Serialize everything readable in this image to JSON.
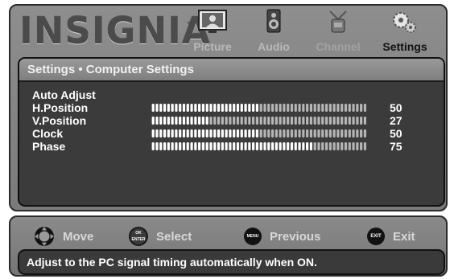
{
  "brand": {
    "logo_text": "INSIGNIA",
    "trademark": "™"
  },
  "tabs": [
    {
      "label": "Picture",
      "icon": "picture-icon",
      "state": "normal"
    },
    {
      "label": "Audio",
      "icon": "audio-icon",
      "state": "normal"
    },
    {
      "label": "Channel",
      "icon": "channel-icon",
      "state": "dim"
    },
    {
      "label": "Settings",
      "icon": "settings-icon",
      "state": "active"
    }
  ],
  "panel": {
    "title": "Settings • Computer Settings",
    "items": [
      {
        "label": "Auto Adjust"
      },
      {
        "label": "H.Position",
        "value": "50",
        "level": 50
      },
      {
        "label": "V.Position",
        "value": "27",
        "level": 27
      },
      {
        "label": "Clock",
        "value": "50",
        "level": 50
      },
      {
        "label": "Phase",
        "value": "75",
        "level": 75
      }
    ]
  },
  "hints": {
    "move": "Move",
    "select": "Select",
    "select_glyph": "OK ENTER",
    "previous": "Previous",
    "previous_glyph": "MENU",
    "exit": "Exit",
    "exit_glyph": "EXIT"
  },
  "status_text": "Adjust to the PC signal timing automatically when ON.",
  "colors": {
    "panel_bg": "#3b3b3b",
    "frame_bg": "#8a8a8a",
    "filled_bar": "#ffffff",
    "empty_bar": "#b5b5b5"
  }
}
